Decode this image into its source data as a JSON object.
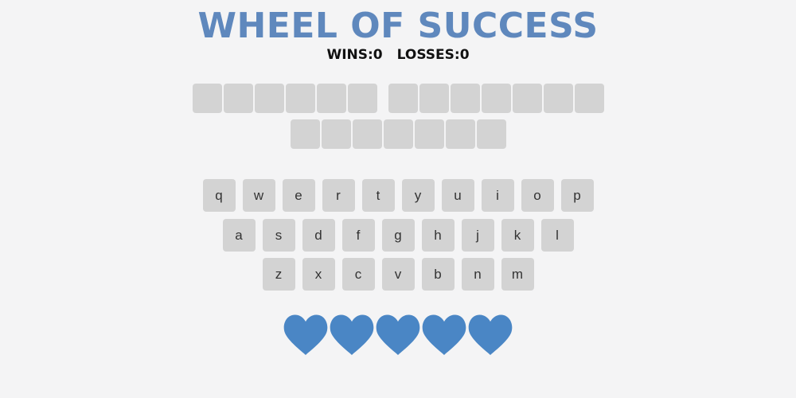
{
  "header": {
    "title": "WHEEL OF SUCCESS",
    "wins_label": "WINS:0",
    "losses_label": "LOSSES:0"
  },
  "puzzle": {
    "word_lengths": [
      6,
      7,
      7
    ],
    "revealed": []
  },
  "keyboard": {
    "rows": [
      [
        "q",
        "w",
        "e",
        "r",
        "t",
        "y",
        "u",
        "i",
        "o",
        "p"
      ],
      [
        "a",
        "s",
        "d",
        "f",
        "g",
        "h",
        "j",
        "k",
        "l"
      ],
      [
        "z",
        "x",
        "c",
        "v",
        "b",
        "n",
        "m"
      ]
    ]
  },
  "lives": {
    "count": 5,
    "heart_color": "#4a86c5"
  },
  "colors": {
    "title": "#5f88bd",
    "tile": "#d3d3d3",
    "background": "#f4f4f5"
  }
}
